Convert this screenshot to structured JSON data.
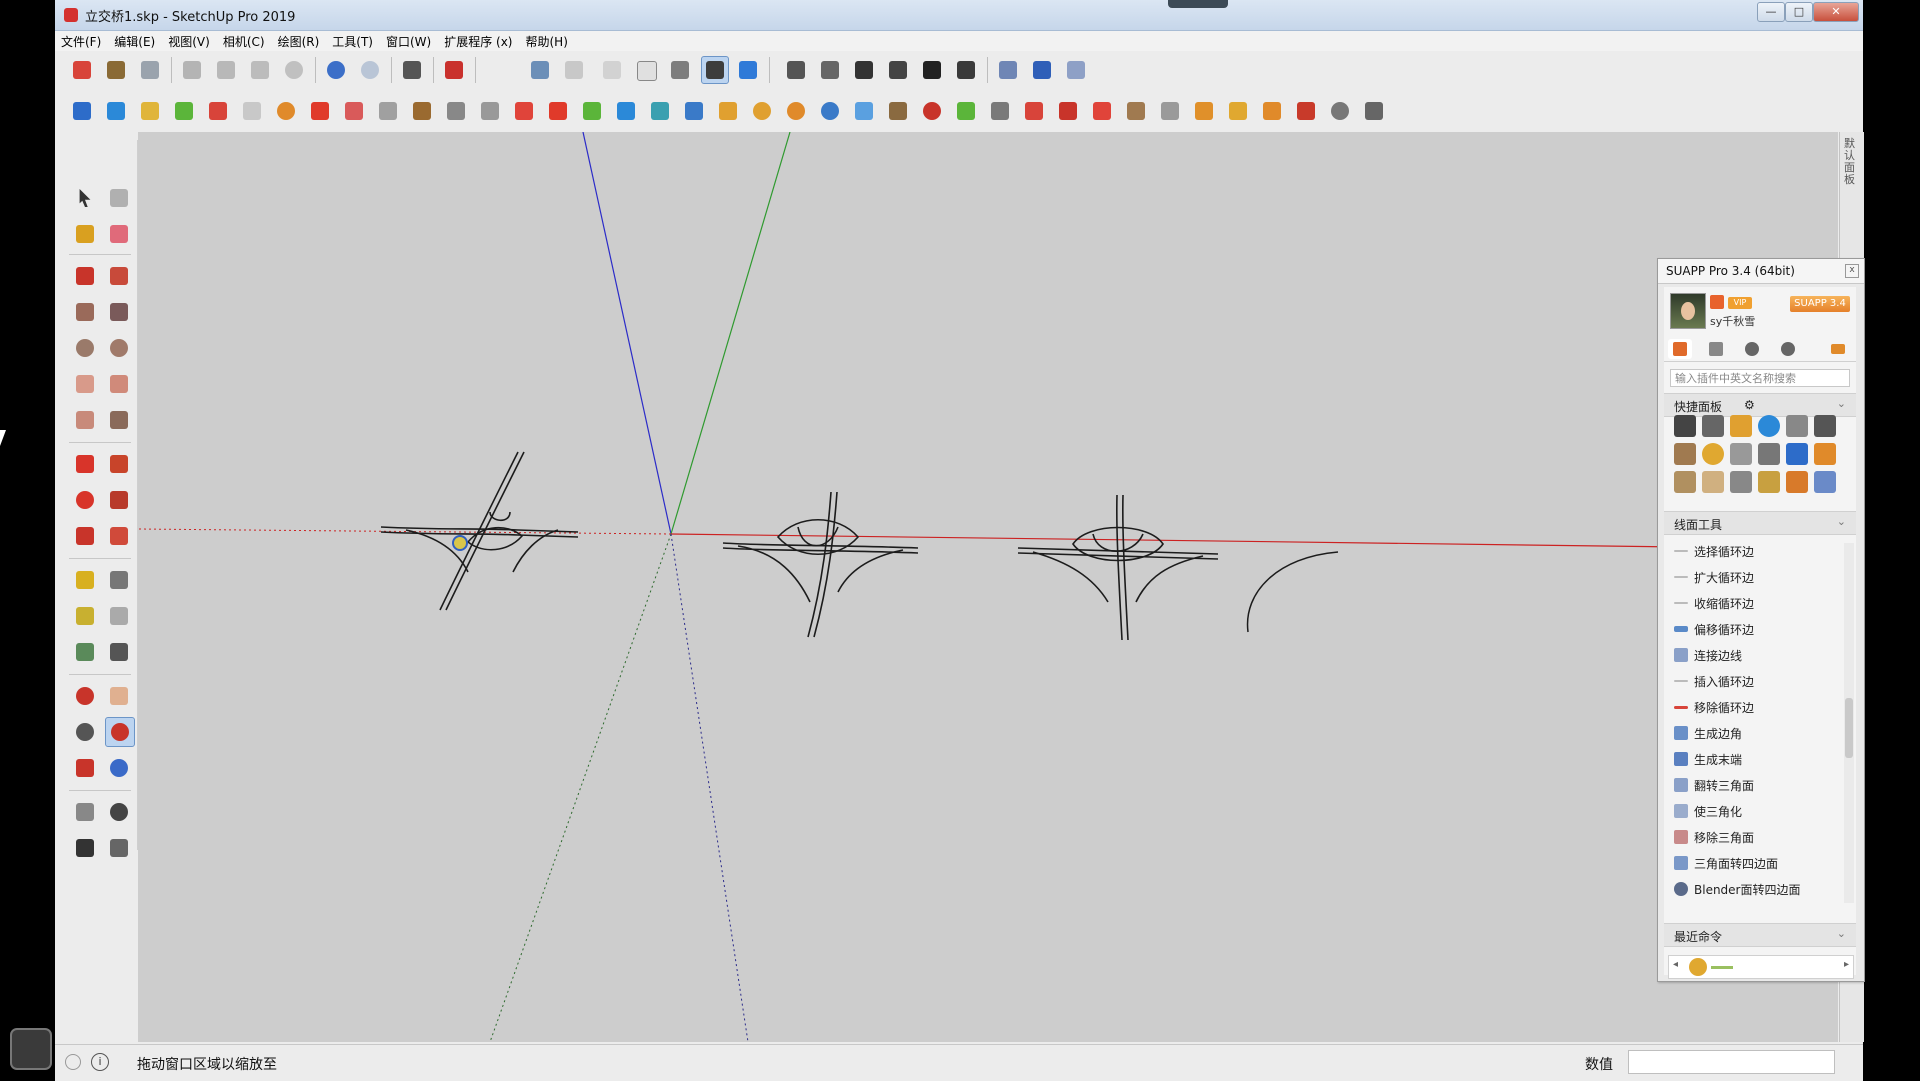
{
  "window": {
    "title": "立交桥1.skp - SketchUp Pro 2019",
    "controls": [
      "—",
      "□",
      "✕"
    ]
  },
  "menu": {
    "items": [
      "文件(F)",
      "编辑(E)",
      "视图(V)",
      "相机(C)",
      "绘图(R)",
      "工具(T)",
      "窗口(W)",
      "扩展程序 (x)",
      "帮助(H)"
    ]
  },
  "right_dock": {
    "label": "默认面板"
  },
  "status": {
    "info_icon": "i",
    "message": "拖动窗口区域以缩放至",
    "value_label": "数值",
    "value": ""
  },
  "suapp": {
    "title": "SUAPP Pro 3.4 (64bit)",
    "close_glyph": "x",
    "username": "sy千秋雪",
    "badge_vip": "VIP",
    "badge_version": "SUAPP 3.4",
    "search_placeholder": "输入插件中英文名称搜索",
    "quick_panel_label": "快捷面板",
    "line_tools_label": "线面工具",
    "recent_label": "最近命令",
    "tools": [
      "选择循环边",
      "扩大循环边",
      "收缩循环边",
      "偏移循环边",
      "连接边线",
      "插入循环边",
      "移除循环边",
      "生成边角",
      "生成末端",
      "翻转三角面",
      "使三角化",
      "移除三角面",
      "三角面转四边面",
      "Blender面转四边面"
    ]
  },
  "colors": {
    "viewport_bg": "#cdcdcd",
    "axis_red": "#cc2222",
    "axis_green": "#2f9a2f",
    "axis_blue": "#2b2bc8",
    "accent_select": "#bcd4f0",
    "suapp_orange": "#e5802a"
  }
}
